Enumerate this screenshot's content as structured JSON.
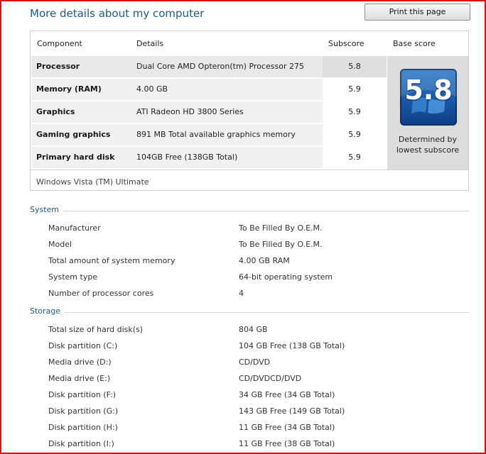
{
  "page": {
    "title": "More details about my computer",
    "print_label": "Print this page"
  },
  "scores": {
    "headers": {
      "component": "Component",
      "details": "Details",
      "subscore": "Subscore",
      "base": "Base score"
    },
    "rows": [
      {
        "component": "Processor",
        "details": "Dual Core AMD Opteron(tm) Processor 275",
        "subscore": "5.8"
      },
      {
        "component": "Memory (RAM)",
        "details": "4.00 GB",
        "subscore": "5.9"
      },
      {
        "component": "Graphics",
        "details": "ATI Radeon HD 3800 Series",
        "subscore": "5.9"
      },
      {
        "component": "Gaming graphics",
        "details": "891 MB Total available graphics memory",
        "subscore": "5.9"
      },
      {
        "component": "Primary hard disk",
        "details": "104GB Free (138GB Total)",
        "subscore": "5.9"
      }
    ],
    "base_score": "5.8",
    "base_note_line1": "Determined by",
    "base_note_line2": "lowest subscore",
    "os": "Windows Vista (TM) Ultimate"
  },
  "system": {
    "title": "System",
    "items": [
      {
        "label": "Manufacturer",
        "value": "To Be Filled By O.E.M."
      },
      {
        "label": "Model",
        "value": "To Be Filled By O.E.M."
      },
      {
        "label": "Total amount of system memory",
        "value": "4.00 GB RAM"
      },
      {
        "label": "System type",
        "value": "64-bit operating system"
      },
      {
        "label": "Number of processor cores",
        "value": "4"
      }
    ]
  },
  "storage": {
    "title": "Storage",
    "items": [
      {
        "label": "Total size of hard disk(s)",
        "value": "804 GB"
      },
      {
        "label": "Disk partition (C:)",
        "value": "104 GB Free (138 GB Total)"
      },
      {
        "label": "Media drive (D:)",
        "value": "CD/DVD"
      },
      {
        "label": "Media drive (E:)",
        "value": "CD/DVDCD/DVD"
      },
      {
        "label": "Disk partition (F:)",
        "value": "34 GB Free (34 GB Total)"
      },
      {
        "label": "Disk partition (G:)",
        "value": "143 GB Free (149 GB Total)"
      },
      {
        "label": "Disk partition (H:)",
        "value": "11 GB Free (34 GB Total)"
      },
      {
        "label": "Disk partition (I:)",
        "value": "11 GB Free (38 GB Total)"
      }
    ]
  }
}
